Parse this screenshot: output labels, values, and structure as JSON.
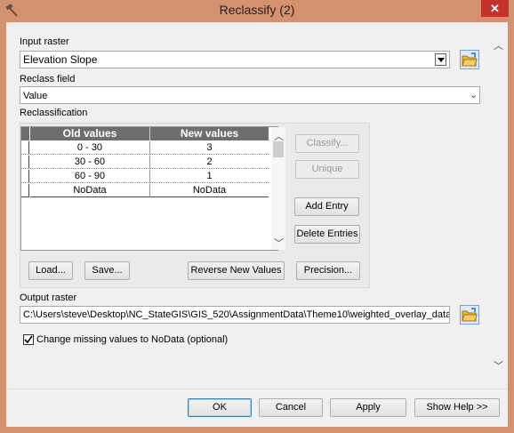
{
  "window": {
    "title": "Reclassify (2)",
    "close_glyph": "✕"
  },
  "input_raster": {
    "label": "Input raster",
    "value": "Elevation Slope"
  },
  "reclass_field": {
    "label": "Reclass field",
    "value": "Value"
  },
  "reclassification": {
    "label": "Reclassification",
    "columns": [
      "Old values",
      "New values"
    ],
    "rows": [
      {
        "old": "0 - 30",
        "new": "3"
      },
      {
        "old": "30 - 60",
        "new": "2"
      },
      {
        "old": "60 - 90",
        "new": "1"
      },
      {
        "old": "NoData",
        "new": "NoData"
      }
    ],
    "side_buttons": {
      "classify": "Classify...",
      "unique": "Unique",
      "add_entry": "Add Entry",
      "delete_entries": "Delete Entries"
    },
    "bottom_buttons": {
      "load": "Load...",
      "save": "Save...",
      "reverse": "Reverse New Values",
      "precision": "Precision..."
    }
  },
  "output_raster": {
    "label": "Output raster",
    "value": "C:\\Users\\steve\\Desktop\\NC_StateGIS\\GIS_520\\AssignmentData\\Theme10\\weighted_overlay_data"
  },
  "change_missing": {
    "label": "Change missing values to NoData (optional)",
    "checked": true
  },
  "dialog_buttons": {
    "ok": "OK",
    "cancel": "Cancel",
    "apply": "Apply",
    "show_help": "Show Help >>"
  },
  "colors": {
    "title_bar": "#d4916f",
    "close": "#c7312b",
    "grid_header": "#6e6e6e",
    "dialog_bg": "#f0f0f0"
  }
}
